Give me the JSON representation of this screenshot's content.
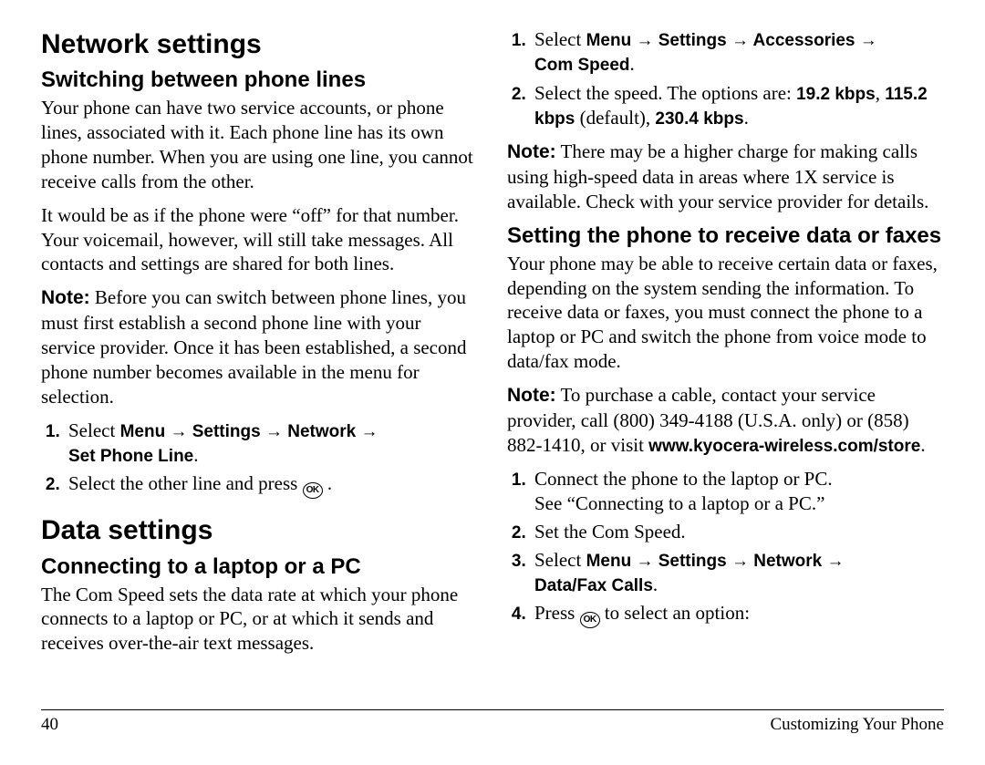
{
  "left": {
    "h1_network": "Network settings",
    "h2_switch": "Switching between phone lines",
    "p1": "Your phone can have two service accounts, or phone lines, associated with it. Each phone line has its own phone number. When you are using one line, you cannot receive calls from the other.",
    "p2": "It would be as if the phone were “off” for that number. Your voicemail, however, will still take messages. All contacts and settings are shared for both lines.",
    "note_label": "Note:",
    "p3_note": " Before you can switch between phone lines, you must first establish a second phone line with your service provider. Once it has been established, a second phone number becomes available in the menu for selection.",
    "step1_pre": "Select ",
    "step1_path": "Menu → Settings → Network → Set Phone Line",
    "step1_post": ".",
    "step2_pre": "Select the other line and press ",
    "step2_post": " .",
    "h1_data": "Data settings",
    "h2_connect": "Connecting to a laptop or a PC",
    "p4": "The Com Speed sets the data rate at which your phone connects to a laptop or PC, or at which it sends and receives over-the-air text messages."
  },
  "right": {
    "cs1_pre": "Select ",
    "cs1_path": "Menu → Settings → Accessories → Com Speed",
    "cs1_post": ".",
    "cs2_pre": "Select the speed. The options are: ",
    "cs2_opt1": "19.2 kbps",
    "cs2_mid1": ", ",
    "cs2_opt2": "115.2 kbps",
    "cs2_mid2": " (default), ",
    "cs2_opt3": "230.4 kbps",
    "cs2_post": ".",
    "note_label": "Note:",
    "p_note_speed": " There may be a higher charge for making calls using high-speed data in areas where 1X service is available. Check with your service provider for details.",
    "h2_receive": "Setting the phone to receive data or faxes",
    "p_receive": "Your phone may be able to receive certain data or faxes, depending on the system sending the information. To receive data or faxes, you must connect the phone to a laptop or PC and switch the phone from voice mode to data/fax mode.",
    "p_cable_pre": " To purchase a cable, contact your service provider, call (800) 349-4188 (U.S.A. only) or (858) 882-1410, or visit ",
    "p_cable_url": "www.kyocera-wireless.com/store",
    "p_cable_post": ".",
    "r1a": "Connect the phone to the laptop or PC.",
    "r1b": "See “Connecting to a laptop or a PC.”",
    "r2": "Set the Com Speed.",
    "r3_pre": "Select ",
    "r3_path": "Menu → Settings → Network → Data/Fax Calls",
    "r3_post": ".",
    "r4_pre": "Press ",
    "r4_post": " to select an option:"
  },
  "ok_label": "OK",
  "footer": {
    "page": "40",
    "section": "Customizing Your Phone"
  }
}
